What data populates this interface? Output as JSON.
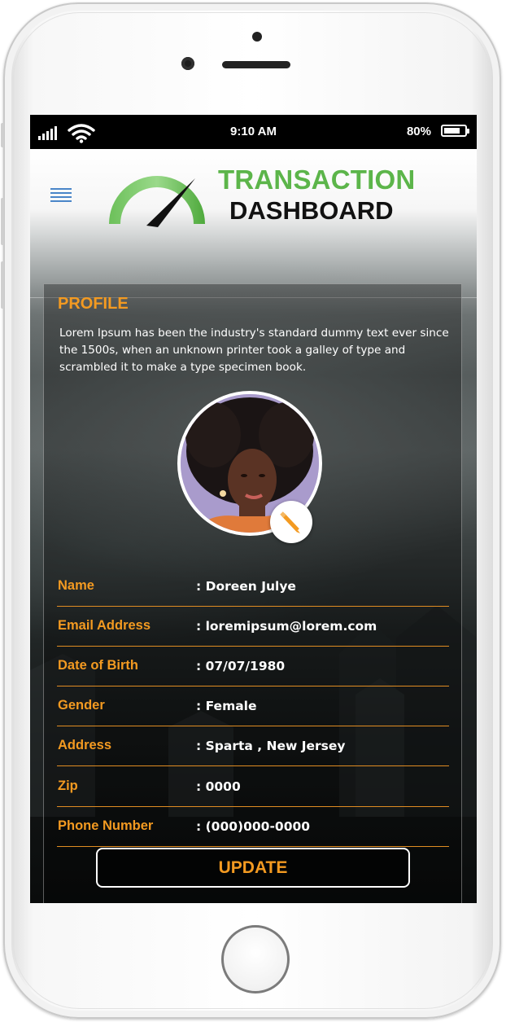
{
  "status_bar": {
    "time": "9:10 AM",
    "battery_percent": "80%",
    "battery_level": 0.8,
    "signal_bars": 5
  },
  "header": {
    "logo_title": "TRANSACTION",
    "logo_subtitle": "DASHBOARD",
    "menu_icon": "hamburger-menu-icon",
    "logo_icon": "speedometer-gauge-icon"
  },
  "profile": {
    "title": "PROFILE",
    "description": "Lorem Ipsum has been the industry's standard dummy text ever since the 1500s, when an unknown printer took a galley of type and scrambled it to make a type specimen book.",
    "edit_icon": "pencil-icon",
    "fields": [
      {
        "label": "Name",
        "value": ": Doreen Julye"
      },
      {
        "label": "Email Address",
        "value": ": loremipsum@lorem.com"
      },
      {
        "label": "Date of Birth",
        "value": ": 07/07/1980"
      },
      {
        "label": "Gender",
        "value": ": Female"
      },
      {
        "label": "Address",
        "value": ": Sparta , New Jersey"
      },
      {
        "label": "Zip",
        "value": ": 0000"
      },
      {
        "label": "Phone Number",
        "value": ": (000)000-0000"
      }
    ],
    "update_label": "UPDATE"
  },
  "colors": {
    "accent_orange": "#f39a21",
    "logo_green": "#5cb54a",
    "menu_blue": "#4a86c8"
  }
}
